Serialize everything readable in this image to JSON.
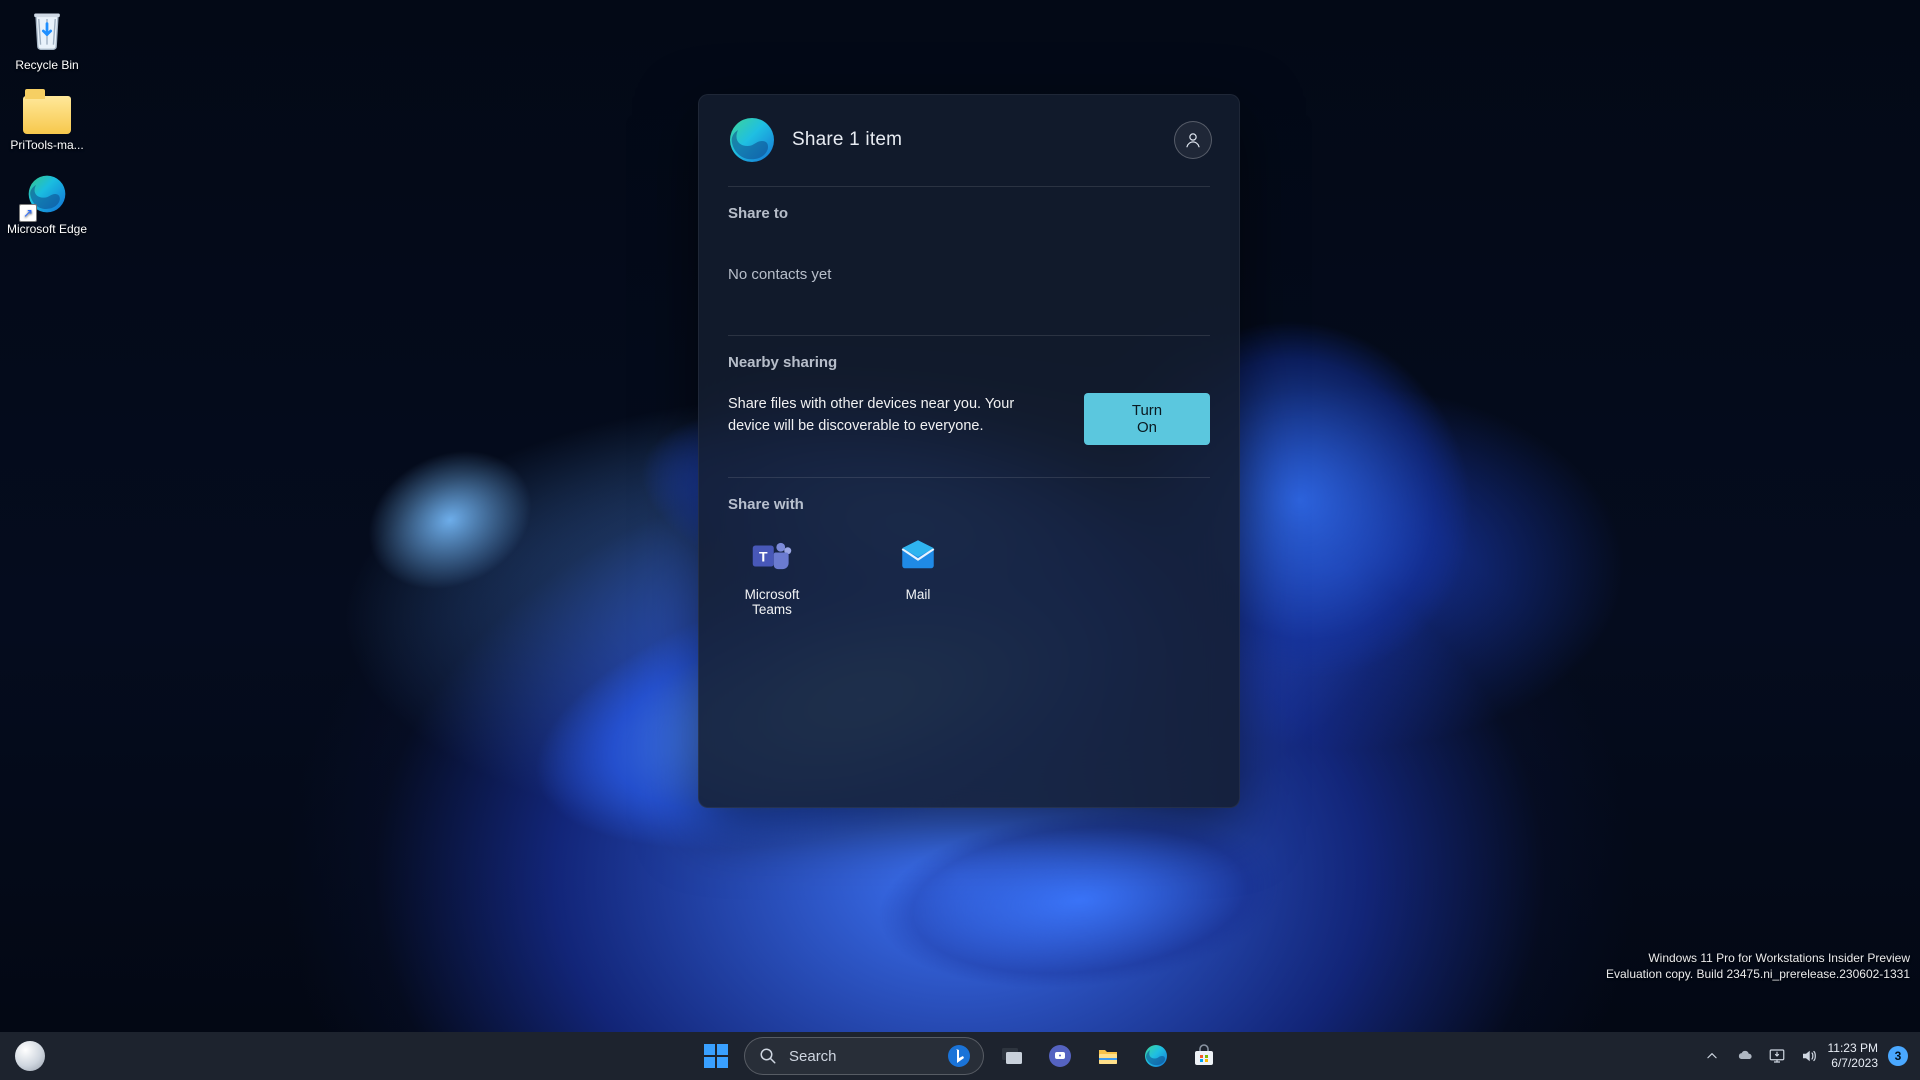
{
  "desktop_icons": {
    "recycle_bin": "Recycle Bin",
    "folder": "PriTools-ma...",
    "edge": "Microsoft Edge"
  },
  "share_dialog": {
    "title": "Share 1 item",
    "share_to_heading": "Share to",
    "no_contacts": "No contacts yet",
    "nearby_heading": "Nearby sharing",
    "nearby_copy": "Share files with other devices near you. Your device will be discoverable to everyone.",
    "turn_on_label": "Turn On",
    "share_with_heading": "Share with",
    "apps": {
      "teams": "Microsoft Teams",
      "mail": "Mail"
    }
  },
  "watermark": {
    "line1": "Windows 11 Pro for Workstations Insider Preview",
    "line2": "Evaluation copy. Build 23475.ni_prerelease.230602-1331"
  },
  "taskbar": {
    "search_label": "Search",
    "time": "11:23 PM",
    "date": "6/7/2023",
    "notifications": "3"
  }
}
